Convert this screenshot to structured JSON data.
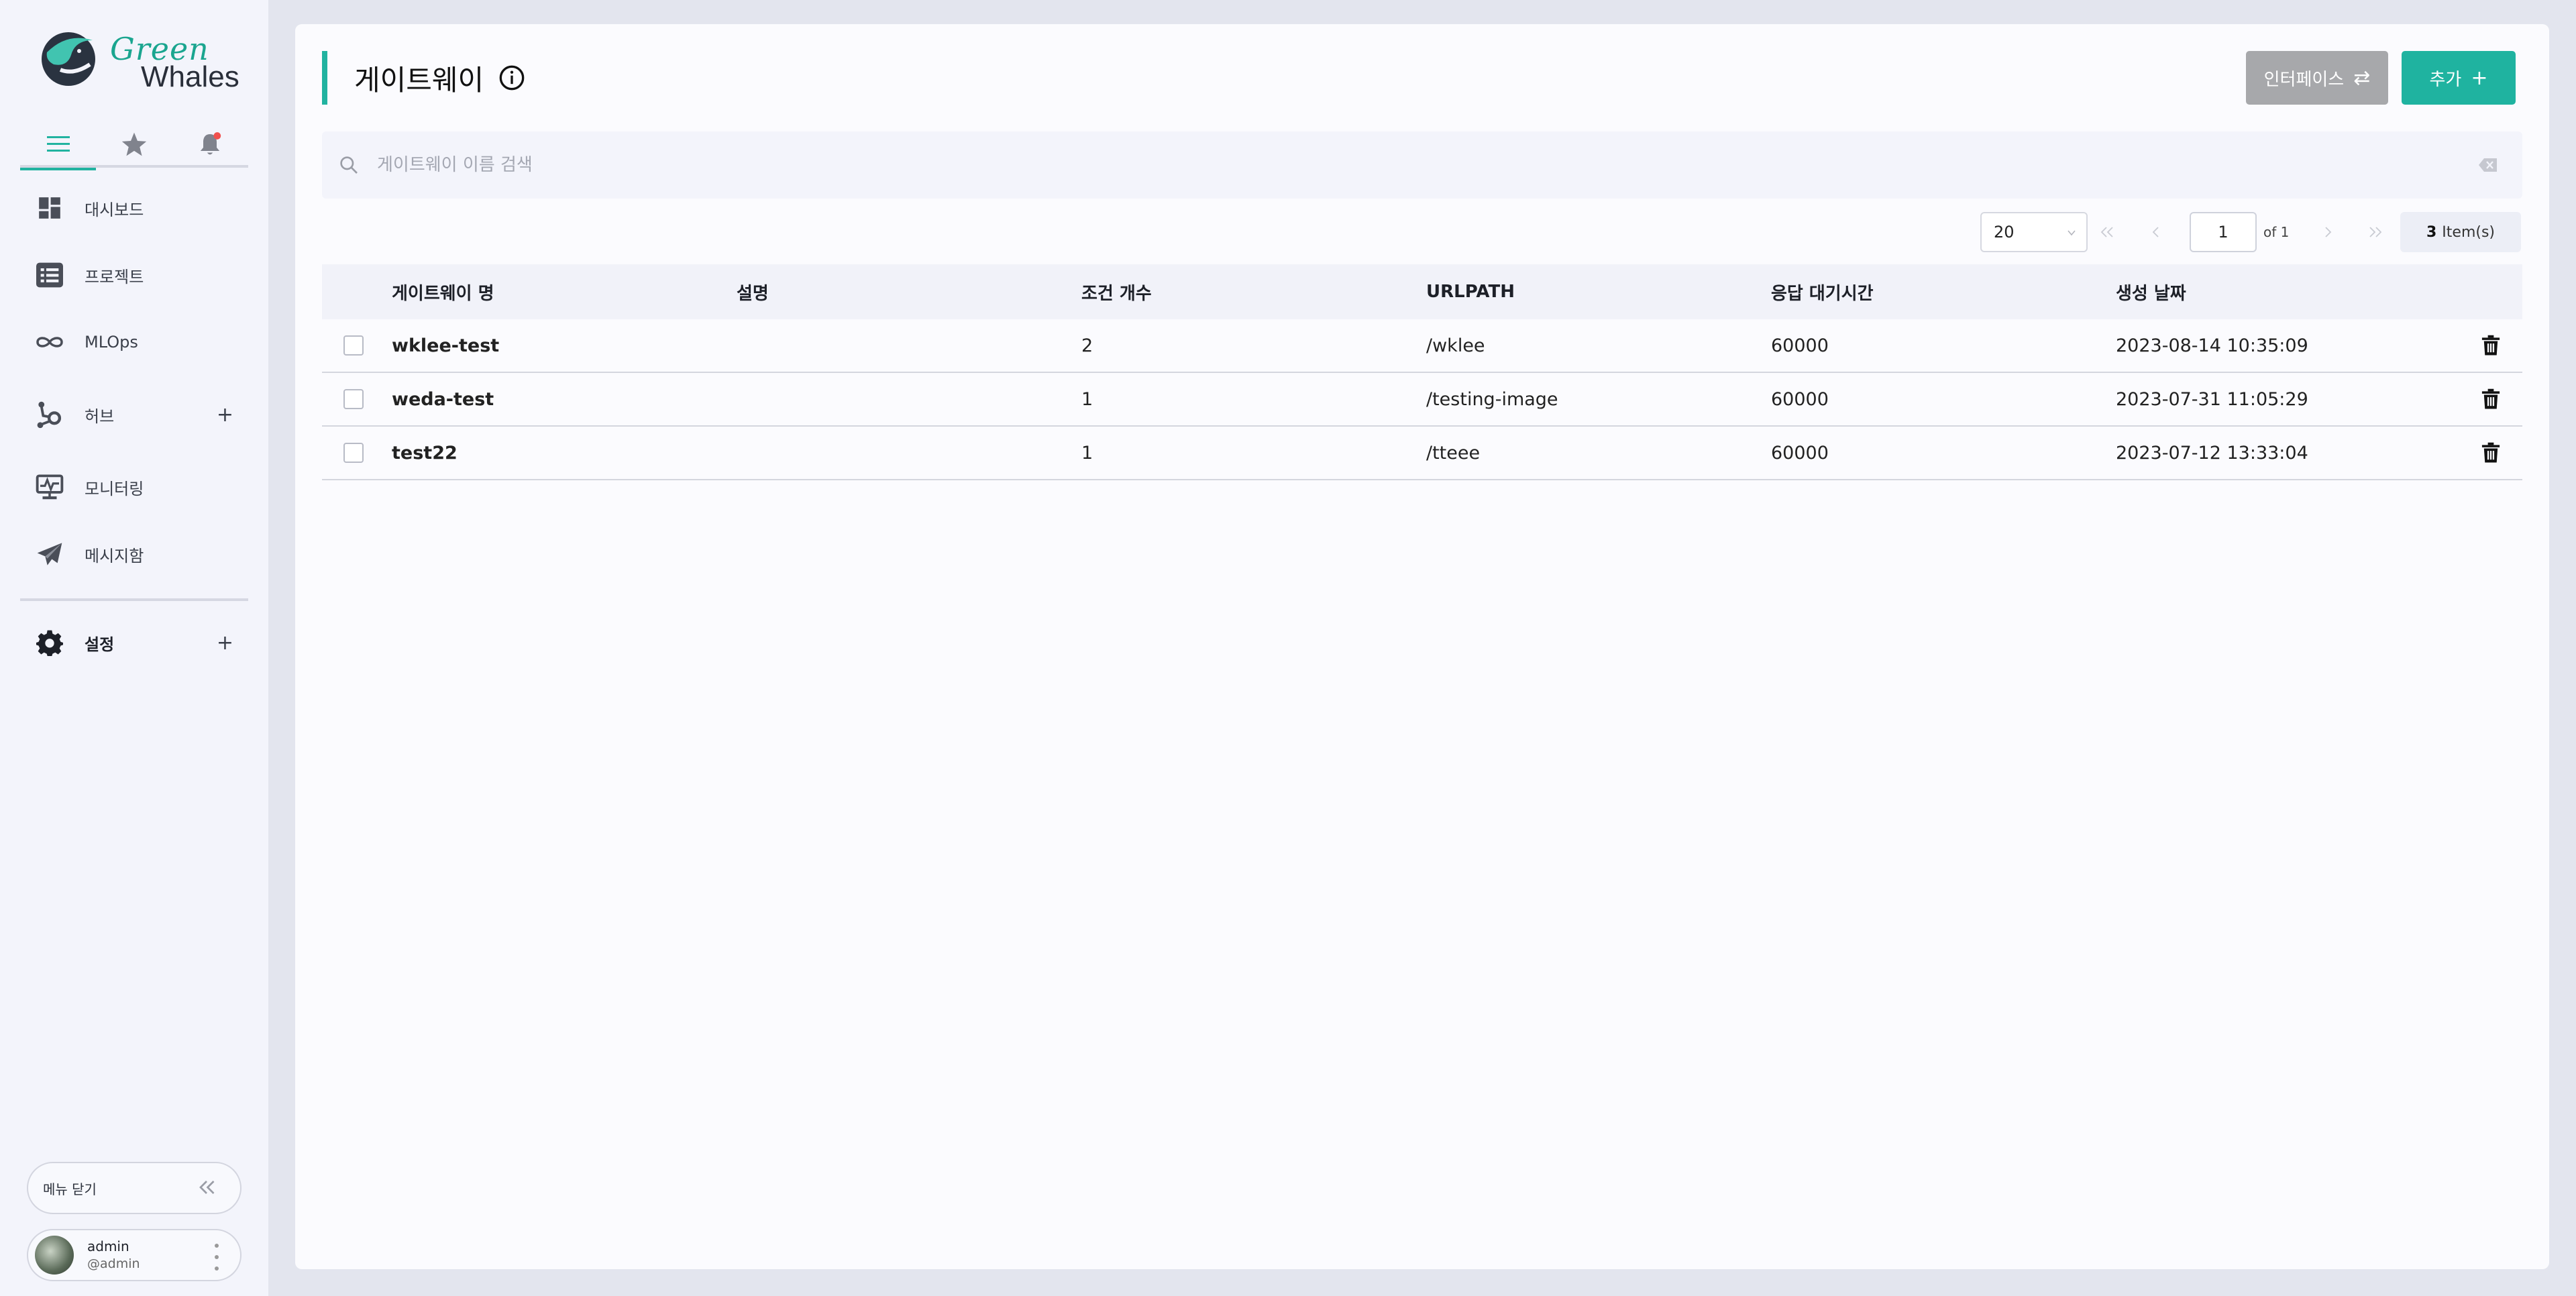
{
  "brand": {
    "line1": "Green",
    "line2": "Whales"
  },
  "sidebar": {
    "tabs": [
      {
        "icon": "menu-icon",
        "active": true
      },
      {
        "icon": "star-icon",
        "active": false
      },
      {
        "icon": "bell-icon",
        "active": false
      }
    ],
    "items": [
      {
        "label": "대시보드",
        "icon": "dashboard-icon"
      },
      {
        "label": "프로젝트",
        "icon": "list-icon"
      },
      {
        "label": "MLOps",
        "icon": "infinity-icon"
      },
      {
        "label": "허브",
        "icon": "hub-icon",
        "expandable": true
      },
      {
        "label": "모니터링",
        "icon": "monitor-icon"
      },
      {
        "label": "메시지함",
        "icon": "send-icon"
      }
    ],
    "settings": {
      "label": "설정",
      "icon": "gear-icon",
      "expandable": true
    },
    "expand_glyph": "+",
    "menu_close": "메뉴 닫기",
    "user": {
      "name": "admin",
      "handle": "@admin"
    }
  },
  "header": {
    "title": "게이트웨이",
    "interface_button": "인터페이스",
    "interface_glyph": "⇄",
    "add_button": "추가",
    "add_glyph": "+"
  },
  "search": {
    "placeholder": "게이트웨이 이름 검색"
  },
  "pagination": {
    "page_size": "20",
    "current_page": "1",
    "of_label": "of 1",
    "item_count": "3",
    "item_label": "Item(s)"
  },
  "table": {
    "columns": [
      "게이트웨이 명",
      "설명",
      "조건 개수",
      "URLPATH",
      "응답 대기시간",
      "생성 날짜"
    ],
    "rows": [
      {
        "name": "wklee-test",
        "description": "",
        "conditions": "2",
        "urlpath": "/wklee",
        "timeout": "60000",
        "created": "2023-08-14 10:35:09"
      },
      {
        "name": "weda-test",
        "description": "",
        "conditions": "1",
        "urlpath": "/testing-image",
        "timeout": "60000",
        "created": "2023-07-31 11:05:29"
      },
      {
        "name": "test22",
        "description": "",
        "conditions": "1",
        "urlpath": "/tteee",
        "timeout": "60000",
        "created": "2023-07-12 13:33:04"
      }
    ]
  },
  "colors": {
    "accent": "#21b3a0",
    "link": "#12998a",
    "disabled_button": "#a7a8ab"
  }
}
